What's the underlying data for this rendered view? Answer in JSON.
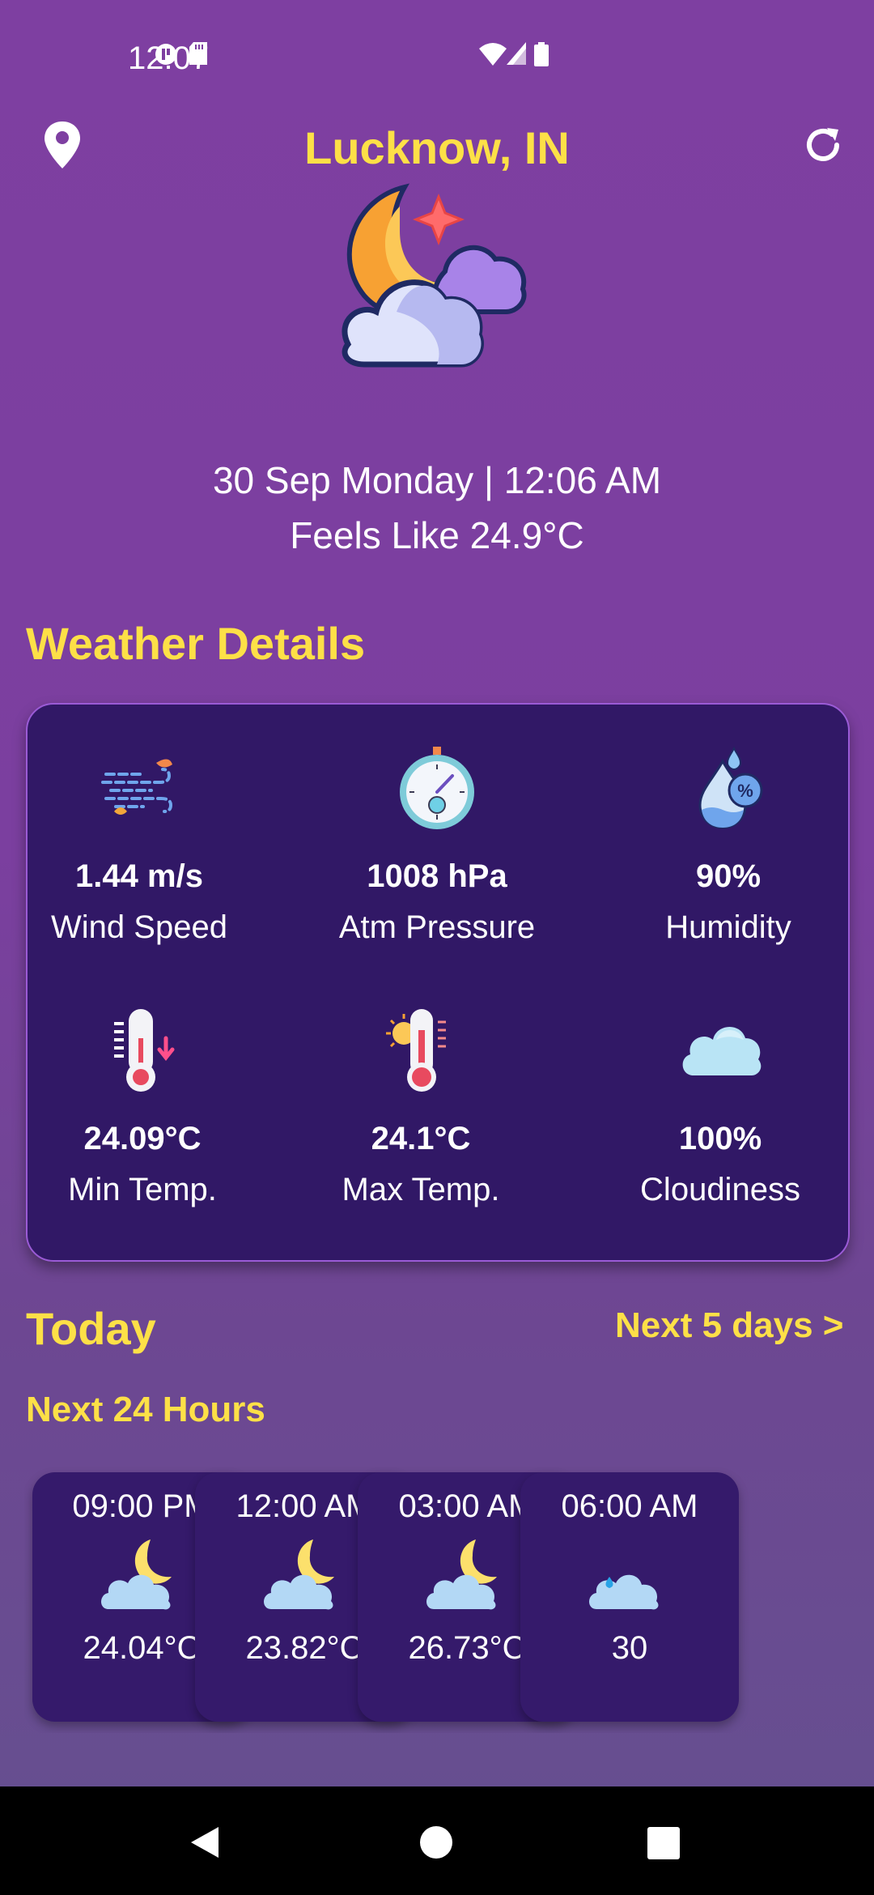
{
  "status": {
    "time": "12:07"
  },
  "header": {
    "city": "Lucknow, IN"
  },
  "current": {
    "date_time": "30 Sep Monday | 12:06 AM",
    "feels_like": "Feels Like 24.9°C",
    "icon": "moon-cloud-star-icon"
  },
  "details": {
    "title": "Weather Details",
    "items": [
      {
        "value": "1.44 m/s",
        "label": "Wind Speed",
        "icon": "wind-icon"
      },
      {
        "value": "1008 hPa",
        "label": "Atm Pressure",
        "icon": "barometer-icon"
      },
      {
        "value": "90%",
        "label": "Humidity",
        "icon": "humidity-icon"
      },
      {
        "value": "24.09°C",
        "label": "Min Temp.",
        "icon": "thermometer-low-icon"
      },
      {
        "value": "24.1°C",
        "label": "Max Temp.",
        "icon": "thermometer-high-icon"
      },
      {
        "value": "100%",
        "label": "Cloudiness",
        "icon": "cloud-icon"
      }
    ]
  },
  "today": {
    "title": "Today",
    "next5_link": "Next 5 days >",
    "next24_title": "Next 24 Hours",
    "hours": [
      {
        "time": "09:00 PM",
        "temp": "24.04°C",
        "icon": "moon-cloud-icon"
      },
      {
        "time": "12:00 AM",
        "temp": "23.82°C",
        "icon": "moon-cloud-icon"
      },
      {
        "time": "03:00 AM",
        "temp": "26.73°C",
        "icon": "moon-cloud-icon"
      },
      {
        "time": "06:00 AM",
        "temp": "30",
        "icon": "rain-cloud-icon"
      }
    ]
  },
  "colors": {
    "accent": "#fde047",
    "card": "#311866",
    "background": "#7e3fa1"
  }
}
